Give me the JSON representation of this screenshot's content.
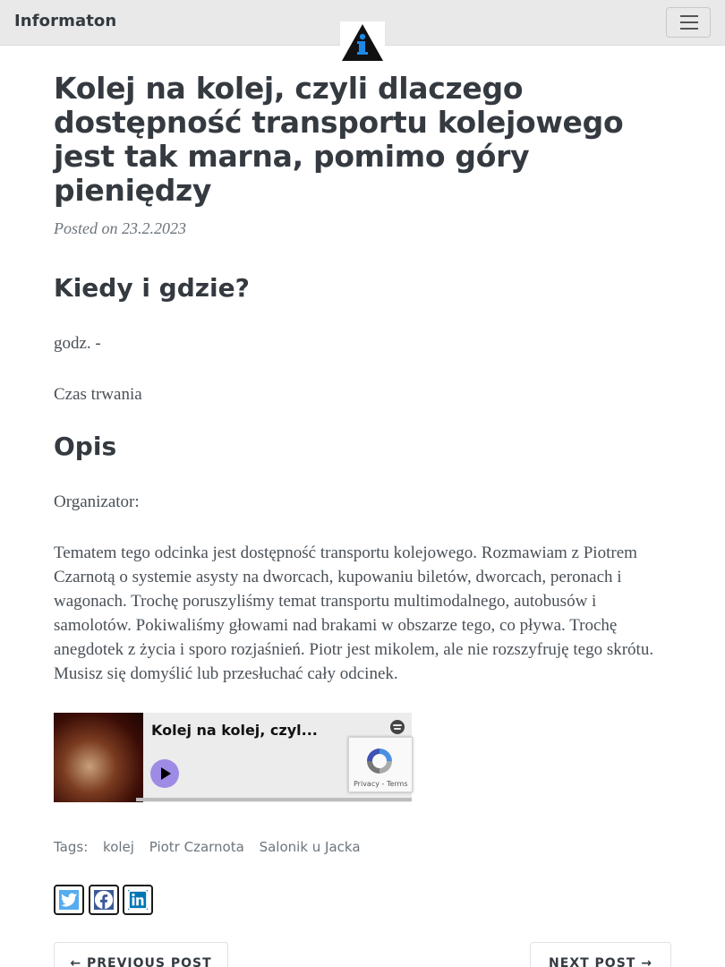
{
  "navbar": {
    "brand": "Informaton",
    "toggle_icon": "hamburger-menu-icon",
    "logo_icon": "info-triangle-logo-icon"
  },
  "post": {
    "title": "Kolej na kolej, czyli dlaczego dostępność transportu kolejowego jest tak marna, pomimo góry pieniędzy",
    "posted": "Posted on 23.2.2023"
  },
  "section_when": {
    "heading": "Kiedy i gdzie?",
    "time": "godz. -",
    "duration": "Czas trwania"
  },
  "section_desc": {
    "heading": "Opis",
    "organizer": "Organizator:",
    "body": "Tematem tego odcinka jest dostępność transportu kolejowego. Rozmawiam z Piotrem Czarnotą o systemie asysty na dworcach, kupowaniu biletów, dworcach, peronach i wagonach. Trochę poruszyliśmy temat transportu multimodalnego, autobusów i samolotów. Pokiwaliśmy głowami nad brakami w obszarze tego, co pływa. Trochę anegdotek z życia i sporo rozjaśnień. Piotr jest mikolem, ale nie rozszyfruję tego skrótu. Musisz się domyślić lub przesłuchać cały odcinek."
  },
  "embed": {
    "title": "Kolej na kolej, czyl...",
    "play_icon": "play-icon",
    "brand_icon": "spotify-icon"
  },
  "recaptcha": {
    "text": "Privacy - Terms"
  },
  "tags": {
    "label": "Tags:",
    "items": [
      "kolej",
      "Piotr Czarnota",
      "Salonik u Jacka"
    ]
  },
  "share": {
    "twitter_color": "#55acee",
    "facebook_color": "#3b5998",
    "linkedin_color": "#0077b5"
  },
  "pager": {
    "previous": "← PREVIOUS POST",
    "next": "NEXT POST →"
  }
}
